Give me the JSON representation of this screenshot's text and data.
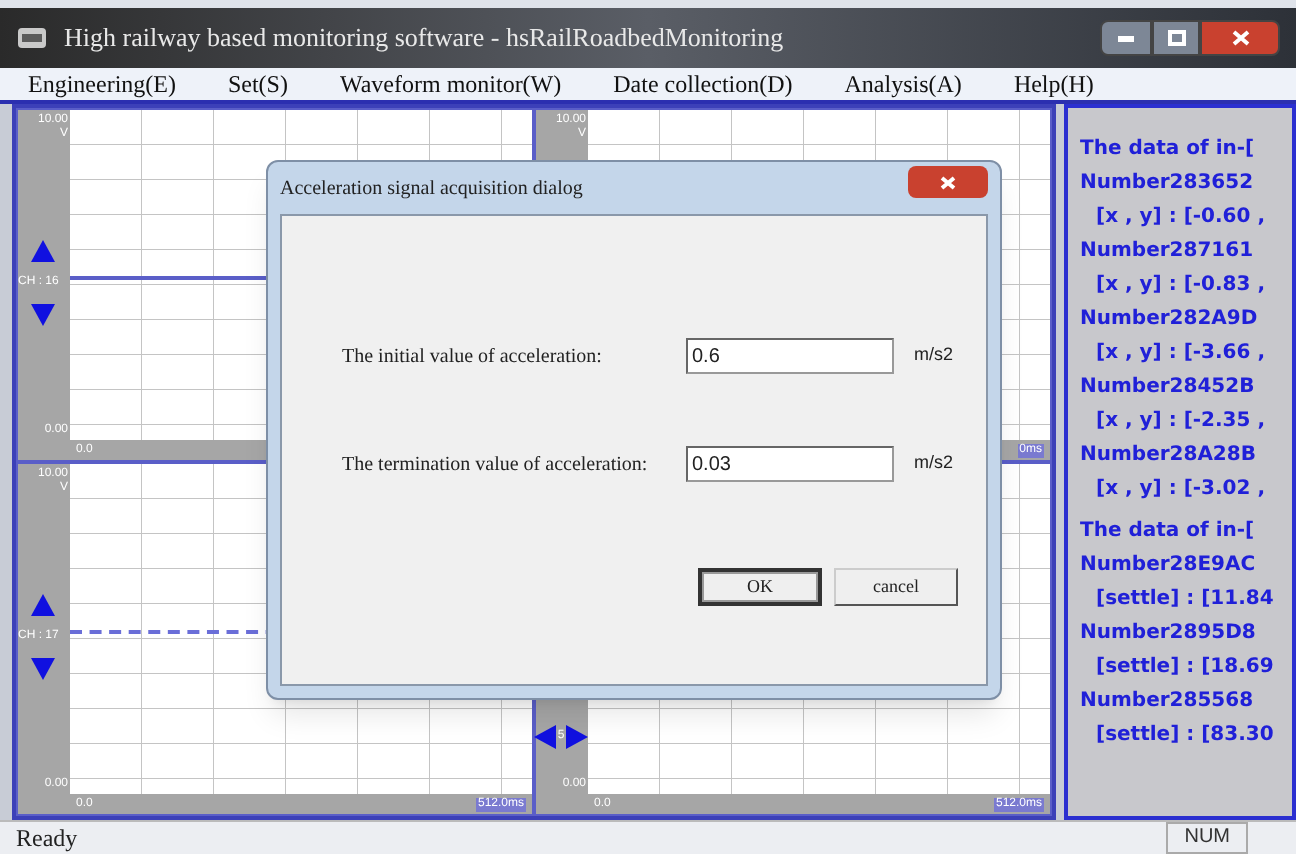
{
  "window": {
    "title": "High railway based monitoring software - hsRailRoadbedMonitoring"
  },
  "menu": [
    "Engineering(E)",
    "Set(S)",
    "Waveform monitor(W)",
    "Date collection(D)",
    "Analysis(A)",
    "Help(H)"
  ],
  "panels": [
    {
      "kind": "channel",
      "y_max": "10.00",
      "y_unit": "V",
      "channel": "CH : 16",
      "y_min": "0.00",
      "x_min": "0.0",
      "trace": {
        "kind": "solid"
      }
    },
    {
      "kind": "plain",
      "y_max": "10.00",
      "y_unit": "V",
      "x_max": "0ms"
    },
    {
      "kind": "channel",
      "y_max": "10.00",
      "y_unit": "V",
      "channel": "CH : 17",
      "y_min": "0.00",
      "x_min": "0.0",
      "x_max": "512.0ms",
      "trace": {
        "kind": "dashed"
      }
    },
    {
      "kind": "step",
      "y_min": "0.00",
      "x_min": "0.0",
      "x_max": "512.0ms",
      "step": "5"
    }
  ],
  "data_panel": {
    "lines": [
      {
        "kind": "heading",
        "text": "The data of in-["
      },
      {
        "kind": "value",
        "text": "Number283652"
      },
      {
        "kind": "value",
        "text": "[x , y] : [-0.60 ,"
      },
      {
        "kind": "value",
        "text": "Number287161"
      },
      {
        "kind": "value",
        "text": "[x , y] : [-0.83 ,"
      },
      {
        "kind": "value",
        "text": "Number282A9D"
      },
      {
        "kind": "value",
        "text": "[x , y] : [-3.66 ,"
      },
      {
        "kind": "value",
        "text": "Number28452B"
      },
      {
        "kind": "value",
        "text": "[x , y] : [-2.35 ,"
      },
      {
        "kind": "value",
        "text": "Number28A28B"
      },
      {
        "kind": "value",
        "text": "[x , y] : [-3.02 ,"
      },
      {
        "kind": "heading",
        "text": "The data of in-["
      },
      {
        "kind": "value",
        "text": "Number28E9AC"
      },
      {
        "kind": "value",
        "text": "[settle] : [11.84"
      },
      {
        "kind": "value",
        "text": "Number2895D8"
      },
      {
        "kind": "value",
        "text": "[settle] : [18.69"
      },
      {
        "kind": "value",
        "text": "Number285568"
      },
      {
        "kind": "value",
        "text": "[settle] : [83.30"
      }
    ]
  },
  "dialog": {
    "title": "Acceleration signal acquisition dialog",
    "fields": [
      {
        "label": "The initial value of acceleration:",
        "value": "0.6",
        "unit": "m/s2"
      },
      {
        "label": "The termination value of acceleration:",
        "value": "0.03",
        "unit": "m/s2"
      }
    ],
    "buttons": [
      {
        "label": "OK",
        "default": true
      },
      {
        "label": "cancel",
        "default": false
      }
    ]
  },
  "status_bar": {
    "message": "Ready",
    "indicator": "NUM"
  }
}
